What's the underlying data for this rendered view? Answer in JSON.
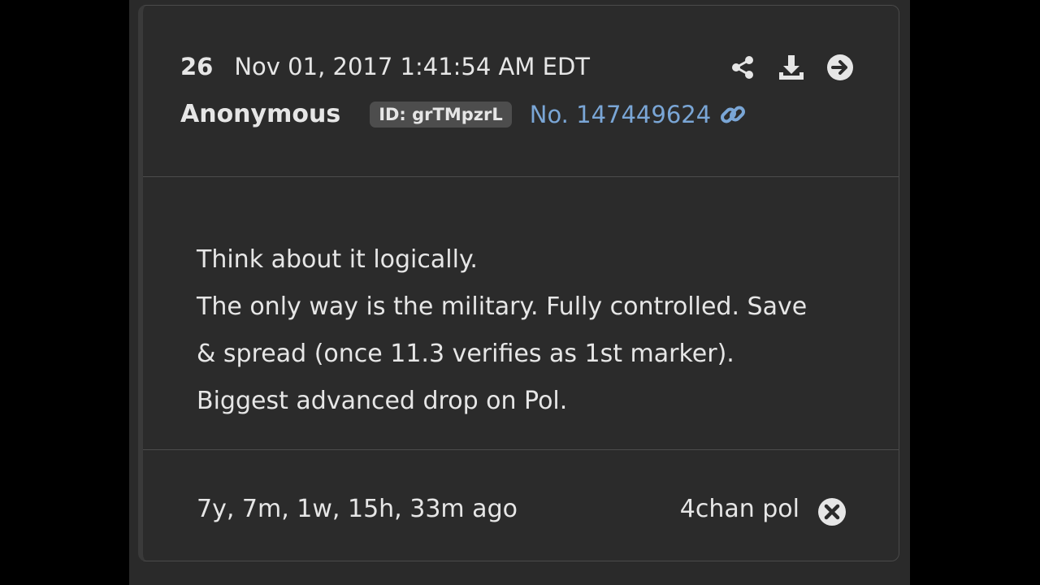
{
  "post": {
    "number": "26",
    "timestamp": "Nov 01, 2017 1:41:54 AM EDT",
    "author": "Anonymous",
    "id_badge": "ID: grTMpzrL",
    "post_link": "No. 147449624",
    "message_lines": [
      "Think about it logically.",
      "The only way is the military. Fully controlled. Save",
      "& spread (once 11.3 verifies as 1st marker).",
      "Biggest advanced drop on Pol."
    ],
    "age": "7y, 7m, 1w, 15h, 33m ago",
    "source": "4chan pol"
  },
  "icons": {
    "share": "share-icon",
    "download": "download-icon",
    "open": "arrow-circle-right-icon",
    "link": "link-icon",
    "close": "close-circle-icon"
  },
  "colors": {
    "background": "#000000",
    "card": "#2b2b2b",
    "text": "#e6e6e6",
    "link": "#7aa6d6",
    "badge": "#4d4d4d"
  }
}
